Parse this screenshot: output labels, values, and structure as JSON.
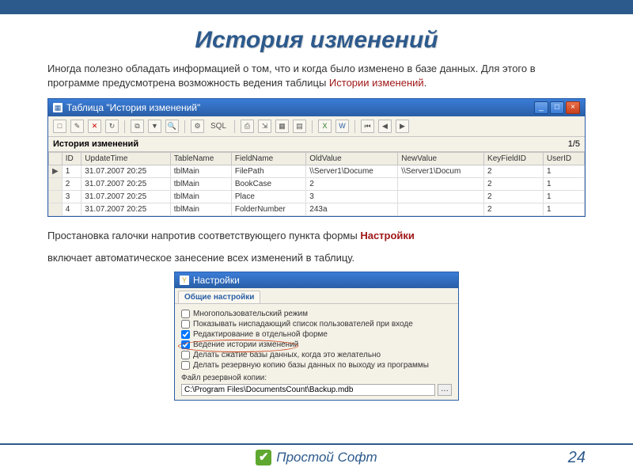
{
  "slide": {
    "title": "История изменений",
    "intro_a": "Иногда полезно обладать информацией о том, что и когда было изменено в базе данных. Для этого в программе предусмотрена возможность ведения таблицы ",
    "intro_hl": "Истории изменений",
    "intro_b": "."
  },
  "window1": {
    "title": "Таблица \"История изменений\"",
    "section": "История изменений",
    "counter": "1/5",
    "columns": [
      "ID",
      "UpdateTime",
      "TableName",
      "FieldName",
      "OldValue",
      "NewValue",
      "KeyFieldID",
      "UserID"
    ],
    "rows": [
      {
        "mark": "▶",
        "id": "1",
        "time": "31.07.2007 20:25",
        "tbl": "tblMain",
        "field": "FilePath",
        "old": "\\\\Server1\\Docume",
        "new": "\\\\Server1\\Docum",
        "key": "2",
        "user": "1"
      },
      {
        "mark": "",
        "id": "2",
        "time": "31.07.2007 20:25",
        "tbl": "tblMain",
        "field": "BookCase",
        "old": "2",
        "new": "",
        "key": "2",
        "user": "1"
      },
      {
        "mark": "",
        "id": "3",
        "time": "31.07.2007 20:25",
        "tbl": "tblMain",
        "field": "Place",
        "old": "3",
        "new": "",
        "key": "2",
        "user": "1"
      },
      {
        "mark": "",
        "id": "4",
        "time": "31.07.2007 20:25",
        "tbl": "tblMain",
        "field": "FolderNumber",
        "old": "243а",
        "new": "",
        "key": "2",
        "user": "1"
      }
    ]
  },
  "para2_a": "Простановка галочки напротив соответствующего пункта формы ",
  "para2_hl": "Настройки",
  "para3": "включает автоматическое занесение всех изменений в таблицу.",
  "settings": {
    "title": "Настройки",
    "tab": "Общие настройки",
    "opts": [
      {
        "checked": false,
        "label": "Многопользовательский режим"
      },
      {
        "checked": false,
        "label": "Показывать ниспадающий список пользователей при входе"
      },
      {
        "checked": true,
        "label": "Редактирование в отдельной форме"
      },
      {
        "checked": true,
        "label": "Ведение истории изменений",
        "ring": true
      },
      {
        "checked": false,
        "label": "Делать сжатие базы данных, когда это желательно"
      },
      {
        "checked": false,
        "label": "Делать резервную копию базы данных по выходу из программы"
      }
    ],
    "file_label": "Файл резервной копии:",
    "file_value": "C:\\Program Files\\DocumentsCount\\Backup.mdb"
  },
  "footer": {
    "brand": "Простой Софт",
    "page": "24"
  }
}
